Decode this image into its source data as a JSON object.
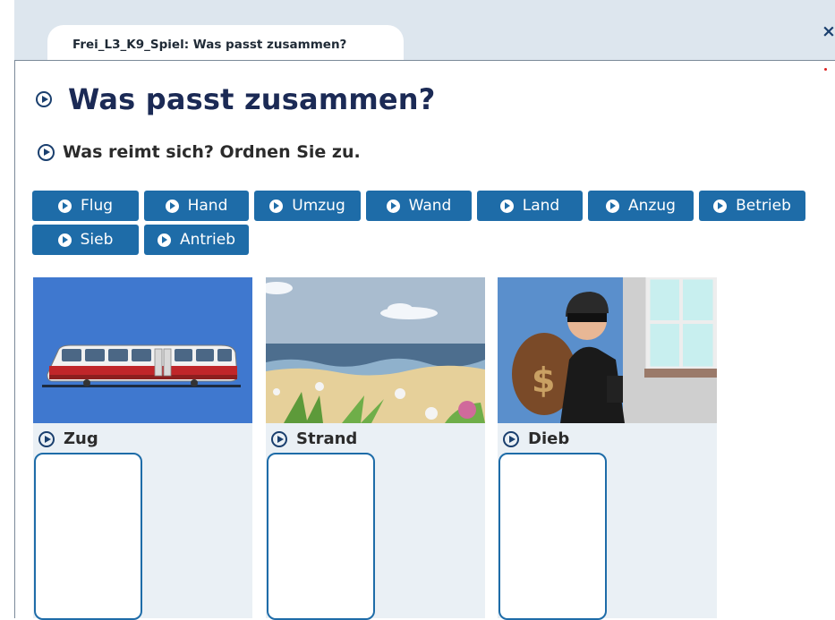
{
  "tab": {
    "title": "Frei_L3_K9_Spiel: Was passt zusammen?"
  },
  "window": {
    "close_glyph": "×"
  },
  "heading": {
    "title": "Was passt zusammen?",
    "instruction": "Was reimt sich? Ordnen Sie zu."
  },
  "words": [
    "Flug",
    "Hand",
    "Umzug",
    "Wand",
    "Land",
    "Anzug",
    "Betrieb",
    "Sieb",
    "Antrieb"
  ],
  "cards": [
    {
      "label": "Zug",
      "image": "train-image"
    },
    {
      "label": "Strand",
      "image": "beach-image"
    },
    {
      "label": "Dieb",
      "image": "thief-image"
    }
  ],
  "colors": {
    "accent": "#1e6ca8",
    "heading": "#1b2a55",
    "panel": "#eaf0f5",
    "topbar": "#dde6ee"
  },
  "icons": {
    "play": "play-circle-icon",
    "close": "close-icon"
  }
}
